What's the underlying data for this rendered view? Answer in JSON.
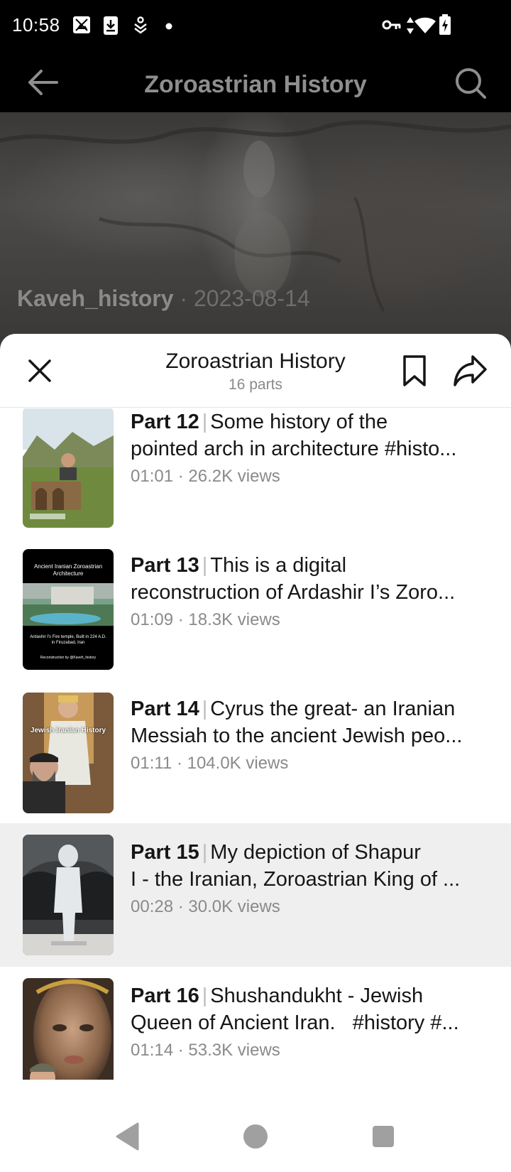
{
  "status_bar": {
    "time": "10:58",
    "icons": [
      "photo-icon",
      "download-icon",
      "vpn-alt-icon",
      "dot-icon",
      "key-icon",
      "data-arrows-icon",
      "wifi-icon",
      "battery-charging-icon"
    ]
  },
  "header": {
    "title": "Zoroastrian History",
    "back_icon": "back-arrow-icon",
    "search_icon": "search-icon"
  },
  "video": {
    "author": "Kaveh_history",
    "separator": " · ",
    "date": "2023-08-14"
  },
  "sheet": {
    "title": "Zoroastrian History",
    "subtitle": "16 parts",
    "close_icon": "close-icon",
    "bookmark_icon": "bookmark-icon",
    "share_icon": "share-icon"
  },
  "parts": [
    {
      "part": "Part 12",
      "line1": "Some history of the",
      "line2": "pointed arch in architecture #histo...",
      "duration": "01:01",
      "views": "26.2K views",
      "active": false
    },
    {
      "part": "Part 13",
      "line1": "This is a digital",
      "line2": "reconstruction of Ardashir I’s Zoro...",
      "duration": "01:09",
      "views": "18.3K views",
      "active": false,
      "thumb_text": {
        "heading": "Ancient Iranian Zoroastrian Architecture",
        "caption": "Ardashir I's Fire temple, Built in 224 A.D. in Firuzabad, Iran",
        "credit": "Reconstruction by @Kaveh_history"
      }
    },
    {
      "part": "Part 14",
      "line1": "Cyrus the great- an Iranian",
      "line2": "Messiah to the ancient Jewish peo...",
      "duration": "01:11",
      "views": "104.0K views",
      "active": false,
      "thumb_text": {
        "heading": "Jewish Iranian History"
      }
    },
    {
      "part": "Part 15",
      "line1": "My depiction of Shapur",
      "line2": "I - the Iranian, Zoroastrian King of ...",
      "duration": "00:28",
      "views": "30.0K views",
      "active": true
    },
    {
      "part": "Part 16",
      "line1": "Shushandukht - Jewish",
      "line2": "Queen of Ancient Iran.   #history #...",
      "duration": "01:14",
      "views": "53.3K views",
      "active": false
    }
  ],
  "nav": {
    "back_icon": "nav-back-icon",
    "home_icon": "nav-home-icon",
    "recents_icon": "nav-recents-icon"
  }
}
